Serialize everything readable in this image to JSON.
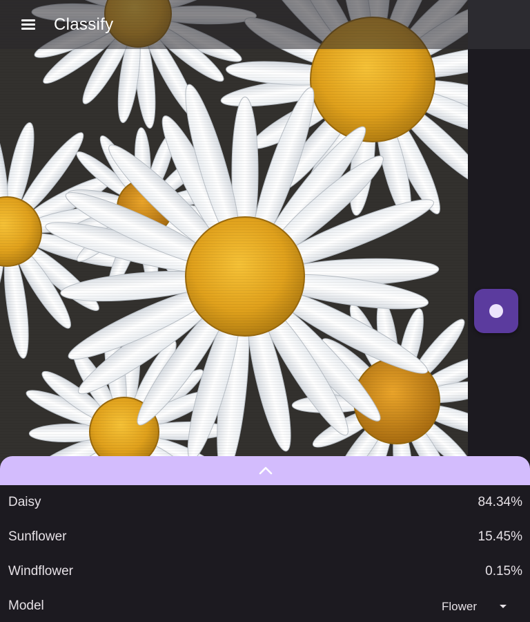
{
  "appbar": {
    "title": "Classify",
    "menu_icon": "menu-icon"
  },
  "camera": {
    "capture_icon": "record-dot-icon"
  },
  "results": [
    {
      "label": "Daisy",
      "value": "84.34%"
    },
    {
      "label": "Sunflower",
      "value": "15.45%"
    },
    {
      "label": "Windflower",
      "value": "0.15%"
    }
  ],
  "model": {
    "label": "Model",
    "selected": "Flower"
  },
  "sheet": {
    "toggle_icon": "chevron-up-icon"
  },
  "colors": {
    "accent": "#d3bcfd",
    "capture_button": "#5b3b9e",
    "background": "#1c1a20",
    "text": "#e6e1e6"
  }
}
